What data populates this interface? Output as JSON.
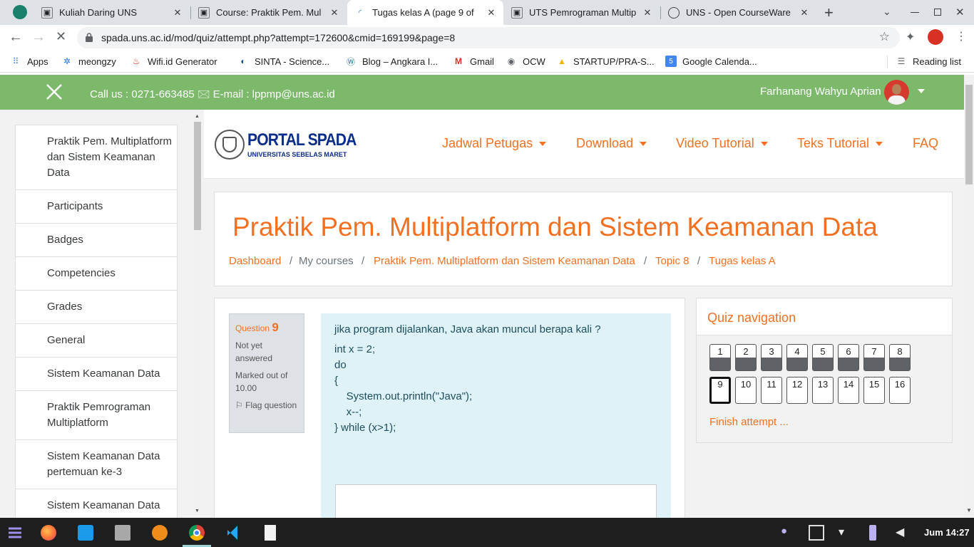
{
  "browser": {
    "tabs": [
      {
        "title": "Kuliah Daring UNS",
        "active": false
      },
      {
        "title": "Course: Praktik Pem. Mul",
        "active": false
      },
      {
        "title": "Tugas kelas A (page 9 of",
        "active": true
      },
      {
        "title": "UTS Pemrograman Multip",
        "active": false
      },
      {
        "title": "UNS - Open CourseWare",
        "active": false
      }
    ],
    "url": "spada.uns.ac.id/mod/quiz/attempt.php?attempt=172600&cmid=169199&page=8",
    "bookmarks": [
      "Apps",
      "meongzy",
      "Wifi.id Generator",
      "SINTA - Science...",
      "Blog – Angkara I...",
      "Gmail",
      "OCW",
      "STARTUP/PRA-S...",
      "Google Calenda..."
    ],
    "reading_list": "Reading list"
  },
  "topbar": {
    "contact": "Call us : 0271-663485 🖂 E-mail : lppmp@uns.ac.id",
    "user_name": "Farhanang Wahyu Aprian"
  },
  "sidebar": {
    "items": [
      {
        "label": "Praktik Pem. Multiplatform dan Sistem Keamanan Data"
      },
      {
        "label": "Participants"
      },
      {
        "label": "Badges"
      },
      {
        "label": "Competencies"
      },
      {
        "label": "Grades"
      },
      {
        "label": "General"
      },
      {
        "label": "Sistem Keamanan Data"
      },
      {
        "label": "Praktik Pemrograman Multiplatform"
      },
      {
        "label": "Sistem Keamanan Data pertemuan ke-3"
      },
      {
        "label": "Sistem Keamanan Data"
      }
    ]
  },
  "site": {
    "logo_title": "PORTAL SPADA",
    "logo_subtitle": "UNIVERSITAS SEBELAS MARET",
    "nav": [
      "Jadwal Petugas",
      "Download",
      "Video Tutorial",
      "Teks Tutorial",
      "FAQ"
    ]
  },
  "course": {
    "title": "Praktik Pem. Multiplatform dan Sistem Keamanan Data",
    "breadcrumb": [
      "Dashboard",
      "My courses",
      "Praktik Pem. Multiplatform dan Sistem Keamanan Data",
      "Topic 8",
      "Tugas kelas A"
    ]
  },
  "question": {
    "label": "Question",
    "number": "9",
    "state": "Not yet answered",
    "marks": "Marked out of 10.00",
    "flag": "Flag question",
    "text": "jika program dijalankan, Java akan muncul berapa kali ?",
    "code": [
      "int x = 2;",
      "do",
      "{",
      "    System.out.println(\"Java\");",
      "    x--;",
      "} while (x>1);"
    ]
  },
  "quiz_nav": {
    "title": "Quiz navigation",
    "row1": [
      "1",
      "2",
      "3",
      "4",
      "5",
      "6",
      "7",
      "8"
    ],
    "row2": [
      "9",
      "10",
      "11",
      "12",
      "13",
      "14",
      "15",
      "16"
    ],
    "current": "9",
    "finish": "Finish attempt ..."
  },
  "taskbar": {
    "clock": "Jum 14:27"
  }
}
